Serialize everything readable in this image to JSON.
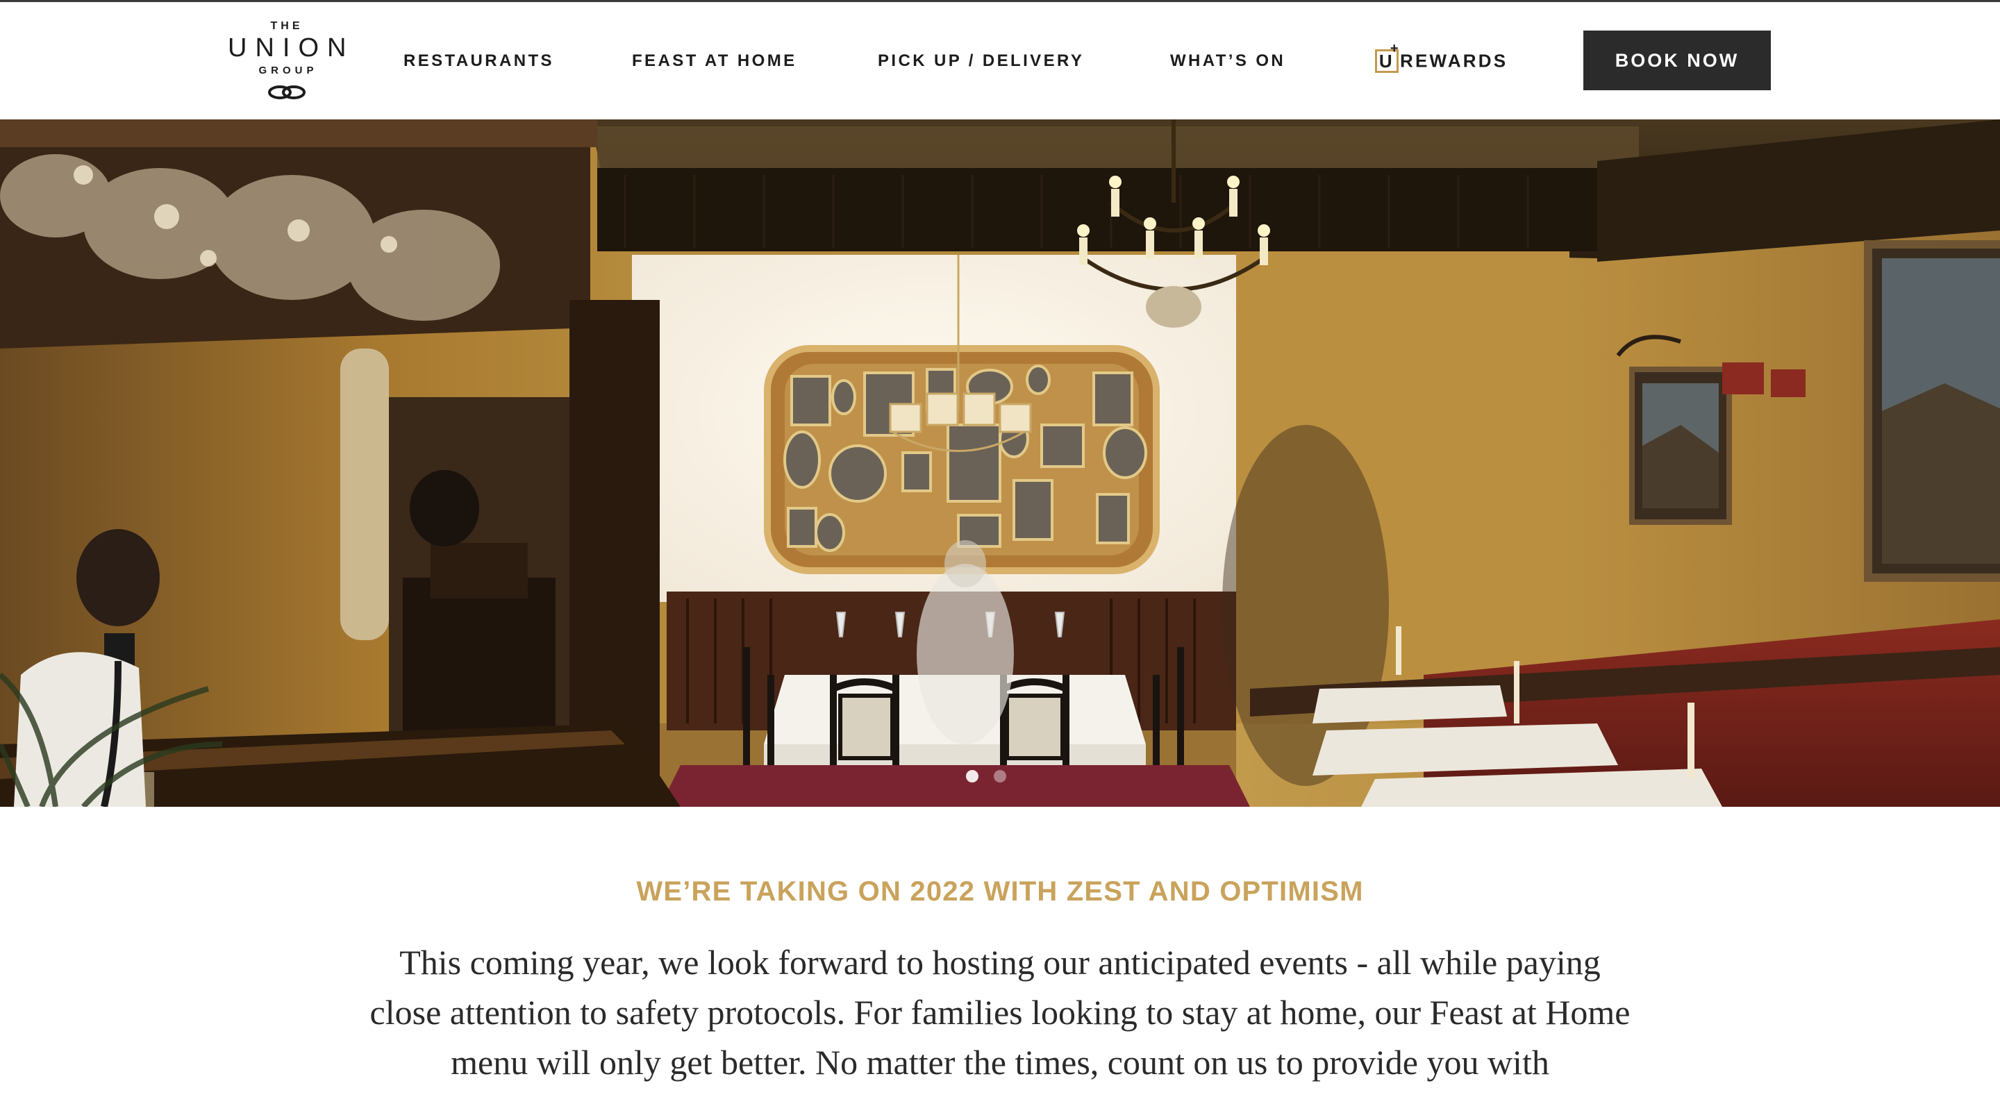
{
  "logo": {
    "the": "THE",
    "union": "UNION",
    "group": "GROUP",
    "icon": "chain-link-icon"
  },
  "nav": {
    "restaurants": "RESTAURANTS",
    "feast_at_home": "FEAST AT HOME",
    "pickup_delivery": "PICK UP / DELIVERY",
    "whats_on": "WHAT’S ON",
    "rewards_u": "U",
    "rewards_label": "REWARDS"
  },
  "book_button": "BOOK NOW",
  "hero": {
    "slides_total": 2,
    "active_slide": 1
  },
  "content": {
    "headline": "WE’RE TAKING ON 2022 WITH ZEST AND OPTIMISM",
    "body": "This coming year, we look forward to hosting our anticipated events - all while paying close attention to safety protocols. For families looking to stay at home, our Feast at Home menu will only get better. No matter the times, count on us to provide you with"
  },
  "colors": {
    "accent": "#c9a35c",
    "button_bg": "#2b2b2b",
    "text": "#1c1c1c"
  }
}
